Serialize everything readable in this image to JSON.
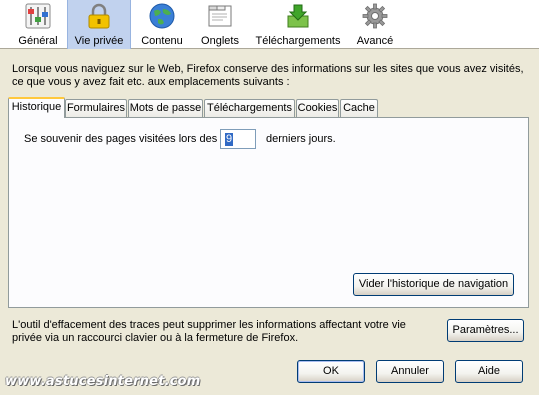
{
  "toolbar": {
    "items": [
      {
        "label": "Général",
        "icon": "general-sliders-icon",
        "selected": false
      },
      {
        "label": "Vie privée",
        "icon": "padlock-icon",
        "selected": true
      },
      {
        "label": "Contenu",
        "icon": "globe-icon",
        "selected": false
      },
      {
        "label": "Onglets",
        "icon": "tabs-window-icon",
        "selected": false
      },
      {
        "label": "Téléchargements",
        "icon": "download-box-icon",
        "selected": false
      },
      {
        "label": "Avancé",
        "icon": "gear-icon",
        "selected": false
      }
    ]
  },
  "description": {
    "line1": "Lorsque vous naviguez sur le Web, Firefox conserve des informations sur les sites que vous avez visités,",
    "line2": "ce que vous y avez fait etc. aux emplacements suivants :"
  },
  "tabs": [
    {
      "label": "Historique",
      "active": true
    },
    {
      "label": "Formulaires",
      "active": false
    },
    {
      "label": "Mots de passe",
      "active": false
    },
    {
      "label": "Téléchargements",
      "active": false
    },
    {
      "label": "Cookies",
      "active": false
    },
    {
      "label": "Cache",
      "active": false
    }
  ],
  "history": {
    "prefix": "Se souvenir des pages visitées lors des",
    "days_value": "9",
    "suffix": "derniers jours.",
    "clear_button": "Vider l'historique de navigation"
  },
  "footer": {
    "text_line1": "L'outil d'effacement des traces peut supprimer les informations affectant votre vie",
    "text_line2": "privée via un raccourci clavier ou à la fermeture de Firefox.",
    "settings_button": "Paramètres..."
  },
  "dialog_buttons": {
    "ok": "OK",
    "cancel": "Annuler",
    "help": "Aide"
  },
  "watermark": "www.astucesinternet.com",
  "colors": {
    "selected_tab_bg": "#c1d2ee",
    "dialog_bg": "#ece9d8",
    "active_tab_highlight": "#ffc83c",
    "button_border": "#003c74"
  }
}
